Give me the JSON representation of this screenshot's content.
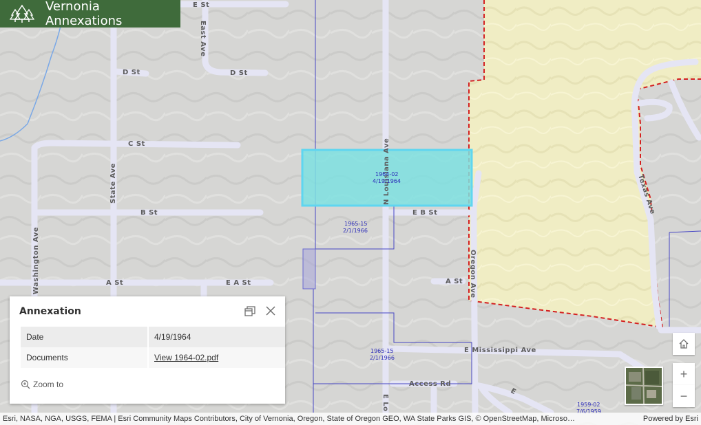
{
  "app": {
    "title": "Vernonia Annexations",
    "logo_icon": "tree-icon"
  },
  "map": {
    "streets": {
      "e_st": "E St",
      "east_ave": "East Ave",
      "d_st_left": "D St",
      "d_st_right": "D St",
      "c_st": "C St",
      "state_ave": "State Ave",
      "b_st": "B St",
      "e_b_st": "E B St",
      "washington_ave": "Washington Ave",
      "a_st_left": "A St",
      "e_a_st": "E A St",
      "a_st_right": "A St",
      "n_louisiana_ave": "N Louisiana Ave",
      "oregon_ave": "Oregon Ave",
      "texas_ave": "Texas Ave",
      "e_mississippi_ave": "E Mississippi Ave",
      "access_rd": "Access Rd",
      "e_lo": "E Lo",
      "e_partial": "E"
    },
    "parcels": [
      {
        "id": "1964-02",
        "date": "4/19/1964"
      },
      {
        "id": "1965-15",
        "date": "2/1/1966"
      },
      {
        "id": "1965-15",
        "date": "2/1/1966"
      },
      {
        "id": "1959-02",
        "date": "7/6/1959"
      }
    ],
    "colors": {
      "highlight": "#7ee0e0",
      "boundary": "#d42020",
      "parcel_line": "#4545c4",
      "annex_fill": "#f2efc4"
    }
  },
  "popup": {
    "title": "Annexation",
    "dock_icon": "dock-icon",
    "close_icon": "close-icon",
    "rows": [
      {
        "key": "Date",
        "value": "4/19/1964"
      },
      {
        "key": "Documents",
        "value": "View 1964-02.pdf"
      }
    ],
    "zoom_label": "Zoom to"
  },
  "controls": {
    "home_icon": "home-icon",
    "zoom_in": "+",
    "zoom_out": "−",
    "basemap_icon": "basemap-thumbnail"
  },
  "attribution": {
    "text": "Esri, NASA, NGA, USGS, FEMA | Esri Community Maps Contributors, City of Vernonia, Oregon, State of Oregon GEO, WA State Parks GIS, © OpenStreetMap, Microso…",
    "powered": "Powered by Esri"
  }
}
